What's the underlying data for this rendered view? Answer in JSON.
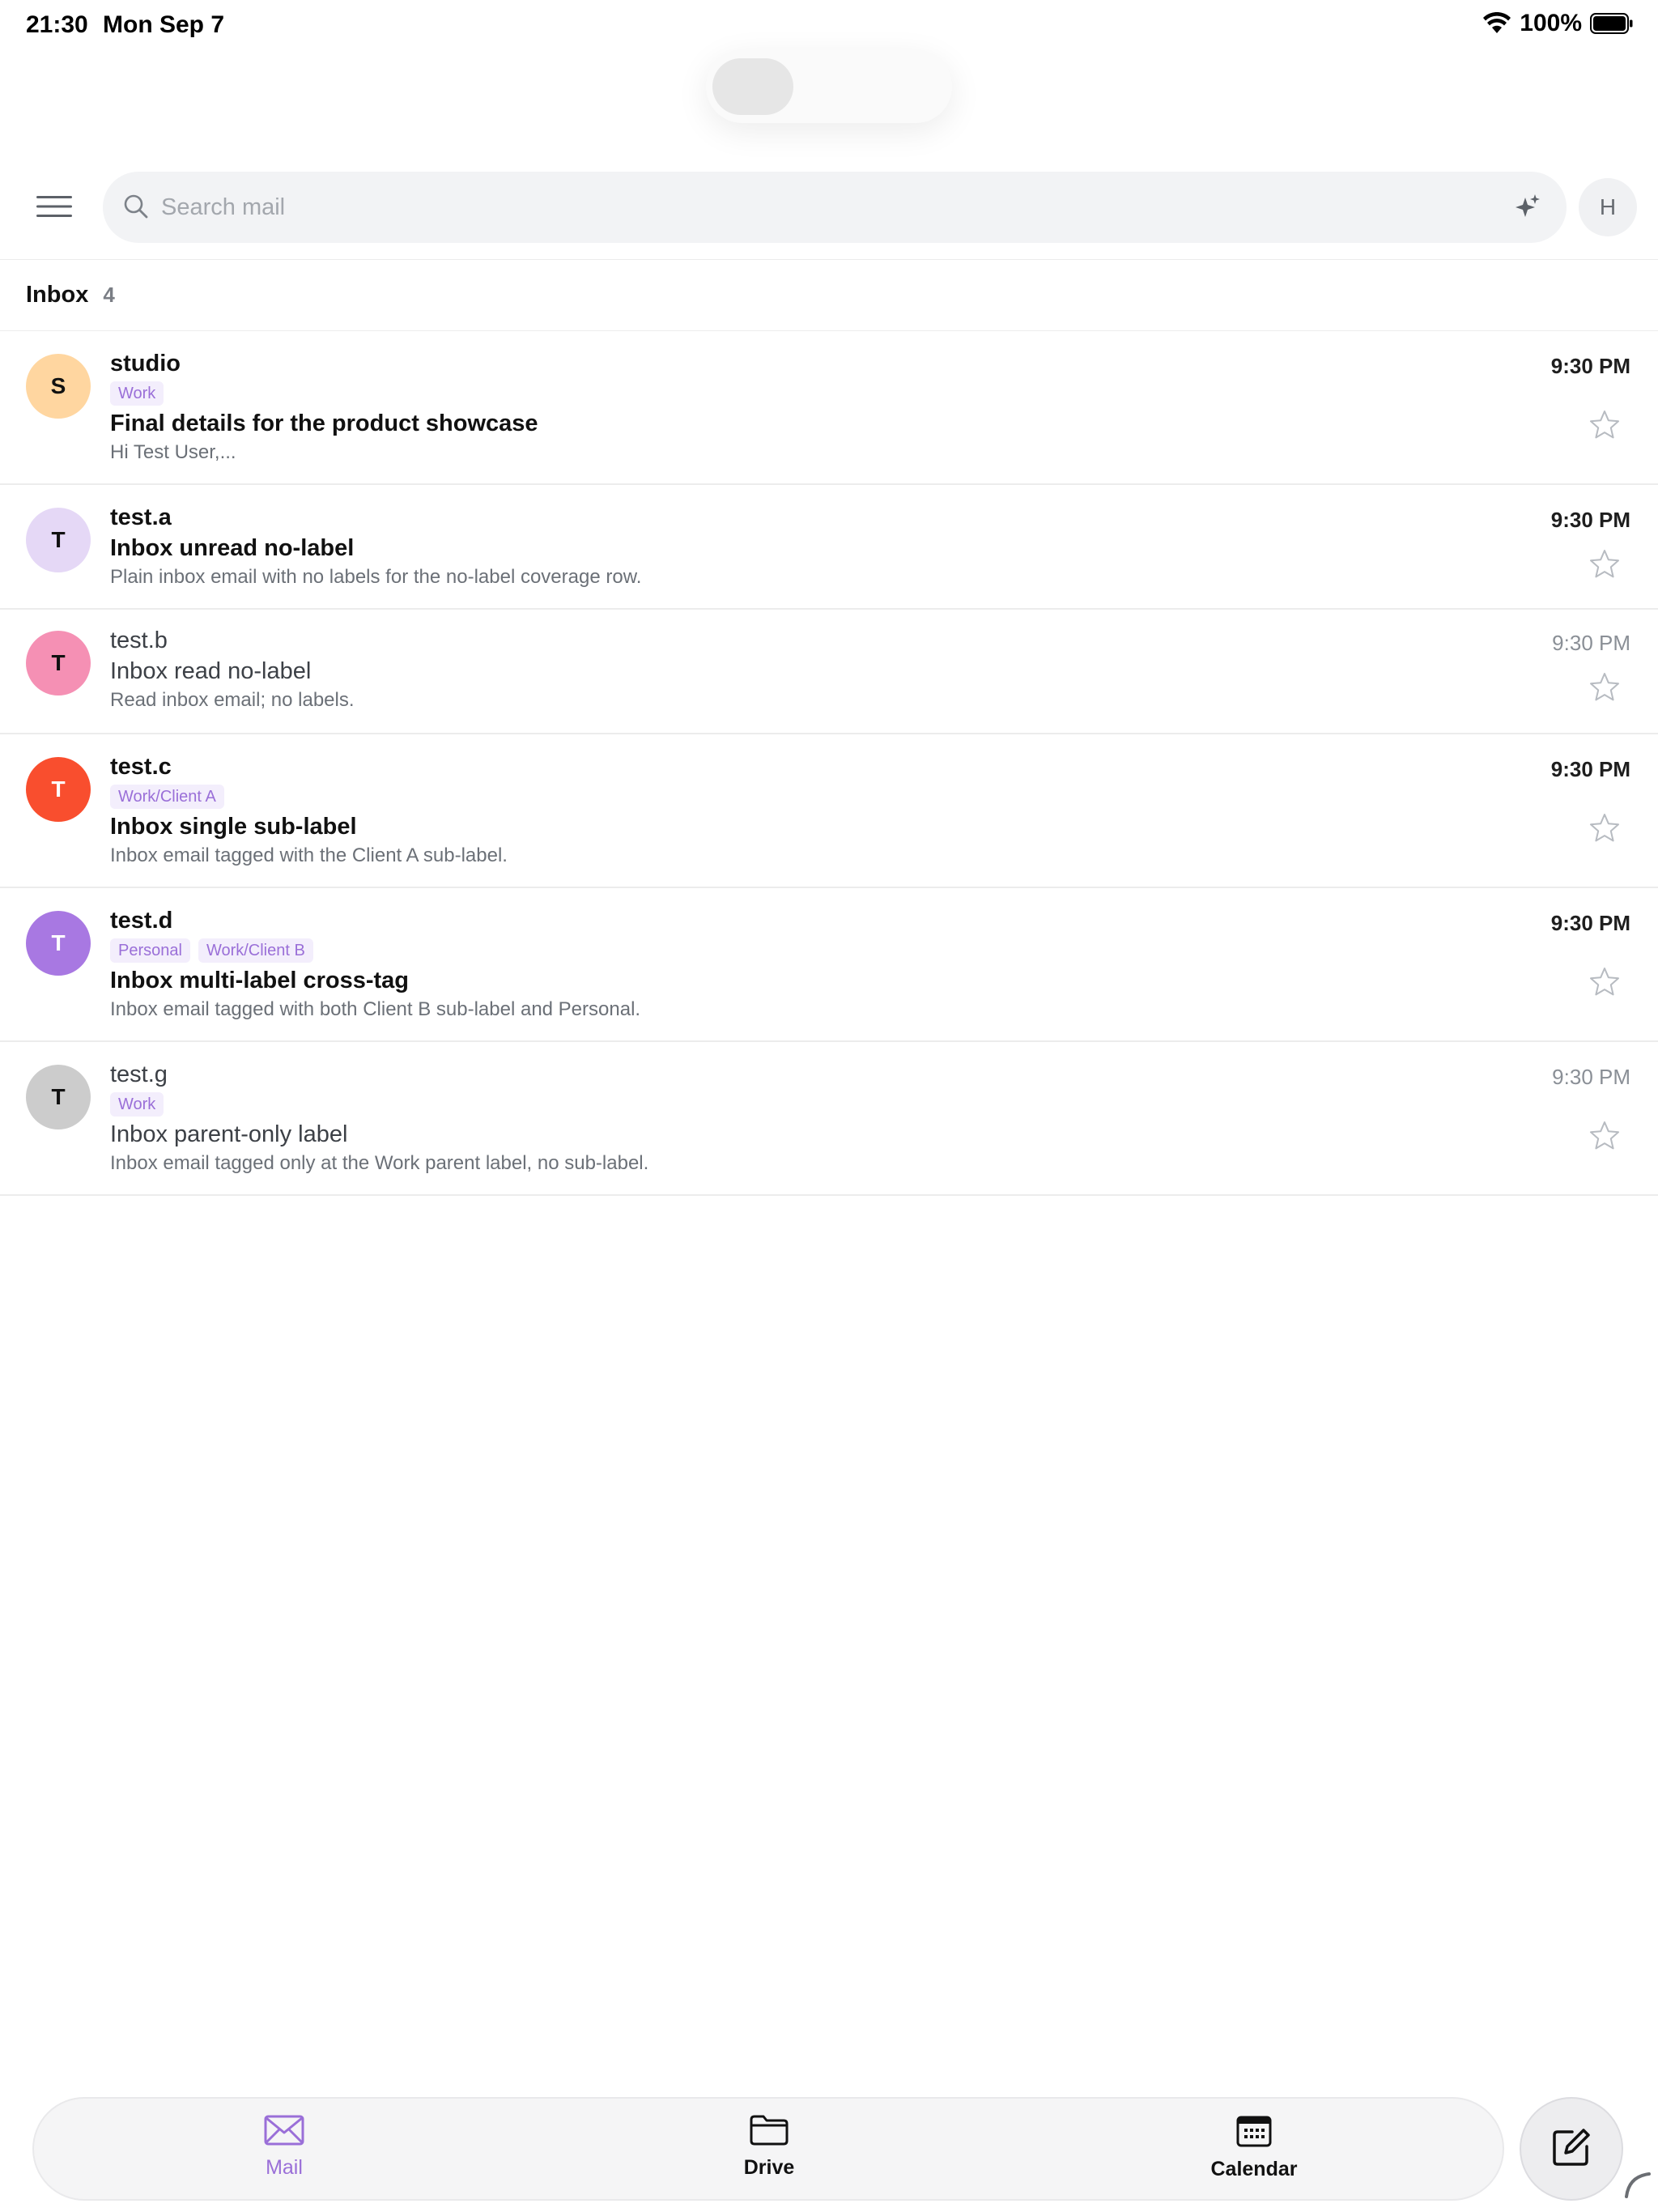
{
  "status_bar": {
    "time": "21:30",
    "date": "Mon Sep 7",
    "battery": "100%"
  },
  "search": {
    "placeholder": "Search mail"
  },
  "account": {
    "initial": "H"
  },
  "inbox": {
    "title": "Inbox",
    "count": "4"
  },
  "emails": [
    {
      "avatar": "S",
      "avatar_bg": "#ffd6a0",
      "avatar_fg": "#111111",
      "sender": "studio",
      "labels": [
        "Work"
      ],
      "subject": "Final details for the product showcase",
      "snippet": "Hi Test User,...",
      "time": "9:30 PM",
      "unread": true
    },
    {
      "avatar": "T",
      "avatar_bg": "#e5d8f6",
      "avatar_fg": "#111111",
      "sender": "test.a",
      "labels": [],
      "subject": "Inbox unread no-label",
      "snippet": "Plain inbox email with no labels for the no-label coverage row.",
      "time": "9:30 PM",
      "unread": true
    },
    {
      "avatar": "T",
      "avatar_bg": "#f590b4",
      "avatar_fg": "#111111",
      "sender": "test.b",
      "labels": [],
      "subject": "Inbox read no-label",
      "snippet": "Read inbox email; no labels.",
      "time": "9:30 PM",
      "unread": false
    },
    {
      "avatar": "T",
      "avatar_bg": "#f94e2e",
      "avatar_fg": "#ffffff",
      "sender": "test.c",
      "labels": [
        "Work/Client A"
      ],
      "subject": "Inbox single sub-label",
      "snippet": "Inbox email tagged with the Client A sub-label.",
      "time": "9:30 PM",
      "unread": true
    },
    {
      "avatar": "T",
      "avatar_bg": "#a878e2",
      "avatar_fg": "#ffffff",
      "sender": "test.d",
      "labels": [
        "Personal",
        "Work/Client B"
      ],
      "subject": "Inbox multi-label cross-tag",
      "snippet": "Inbox email tagged with both Client B sub-label and Personal.",
      "time": "9:30 PM",
      "unread": true
    },
    {
      "avatar": "T",
      "avatar_bg": "#cccccc",
      "avatar_fg": "#111111",
      "sender": "test.g",
      "labels": [
        "Work"
      ],
      "subject": "Inbox parent-only label",
      "snippet": "Inbox email tagged only at the Work parent label, no sub-label.",
      "time": "9:30 PM",
      "unread": false
    }
  ],
  "tabs": {
    "mail": "Mail",
    "drive": "Drive",
    "calendar": "Calendar"
  },
  "colors": {
    "accent": "#9a6fd8"
  },
  "icons": {
    "menu": "hamburger-icon",
    "search": "search-icon",
    "ai": "sparkle-icon",
    "star": "star-outline-icon",
    "compose": "compose-icon"
  }
}
